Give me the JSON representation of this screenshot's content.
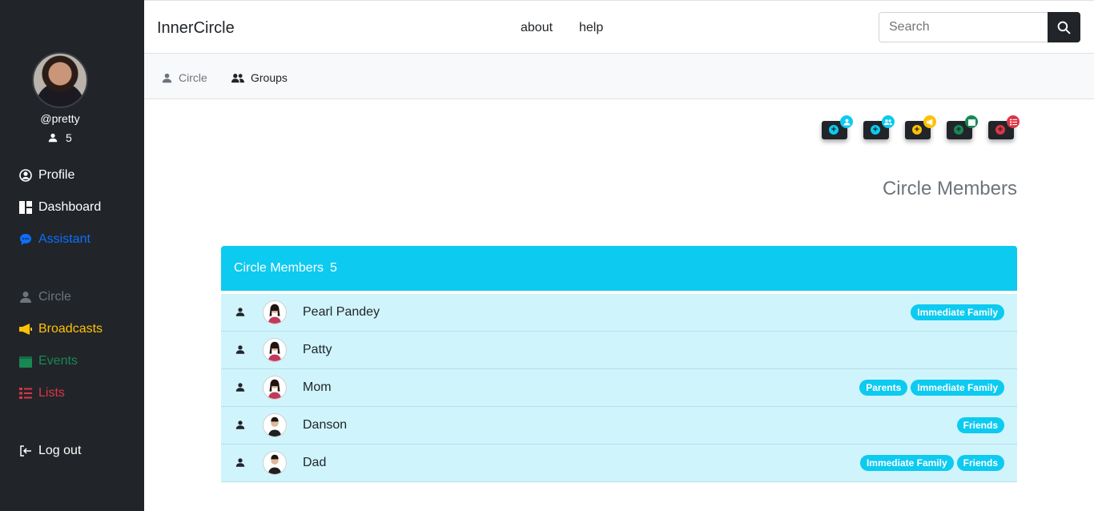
{
  "sidebar": {
    "handle": "@pretty",
    "count": "5",
    "nav": [
      {
        "label": "Profile",
        "icon": "user-circle-icon",
        "color": "#ffffff"
      },
      {
        "label": "Dashboard",
        "icon": "dashboard-icon",
        "color": "#ffffff"
      },
      {
        "label": "Assistant",
        "icon": "chat-bubble-icon",
        "color": "#0d6efd"
      },
      {
        "label": "Circle",
        "icon": "user-icon",
        "color": "#6c757d"
      },
      {
        "label": "Broadcasts",
        "icon": "megaphone-icon",
        "color": "#ffc107"
      },
      {
        "label": "Events",
        "icon": "calendar-icon",
        "color": "#198754"
      },
      {
        "label": "Lists",
        "icon": "list-icon",
        "color": "#dc3545"
      },
      {
        "label": "Log out",
        "icon": "logout-icon",
        "color": "#ffffff"
      }
    ]
  },
  "header": {
    "brand": "InnerCircle",
    "links": [
      "about",
      "help"
    ],
    "search_placeholder": "Search"
  },
  "subnav": {
    "tabs": [
      {
        "label": "Circle",
        "icon": "user-icon"
      },
      {
        "label": "Groups",
        "icon": "users-icon"
      }
    ]
  },
  "actions": [
    {
      "name": "add-member-button",
      "color": "#0dcaf0",
      "icon": "user-icon"
    },
    {
      "name": "add-group-button",
      "color": "#0dcaf0",
      "icon": "users-icon"
    },
    {
      "name": "add-broadcast-button",
      "color": "#ffc107",
      "icon": "megaphone-icon"
    },
    {
      "name": "add-event-button",
      "color": "#198754",
      "icon": "calendar-icon"
    },
    {
      "name": "add-list-button",
      "color": "#dc3545",
      "icon": "list-icon"
    }
  ],
  "main": {
    "title": "Circle Members",
    "card_title": "Circle Members",
    "card_count": "5",
    "members": [
      {
        "name": "Pearl Pandey",
        "gender": "f",
        "tags": [
          "Immediate Family"
        ]
      },
      {
        "name": "Patty",
        "gender": "f",
        "tags": []
      },
      {
        "name": "Mom",
        "gender": "f",
        "tags": [
          "Parents",
          "Immediate Family"
        ]
      },
      {
        "name": "Danson",
        "gender": "m",
        "tags": [
          "Friends"
        ]
      },
      {
        "name": "Dad",
        "gender": "m",
        "tags": [
          "Immediate Family",
          "Friends"
        ]
      }
    ]
  }
}
